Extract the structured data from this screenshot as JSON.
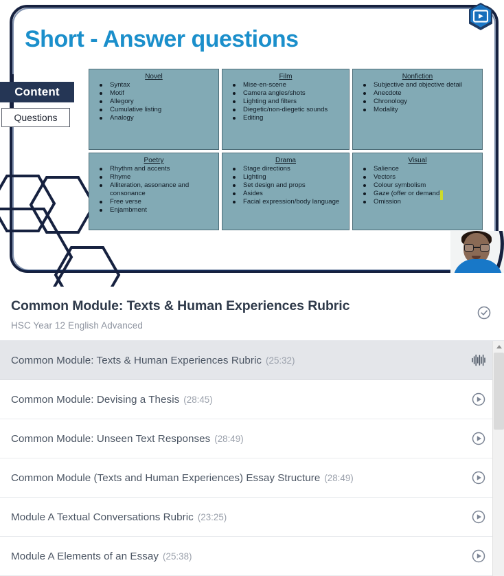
{
  "slide": {
    "title": "Short - Answer questions",
    "tabs": [
      {
        "label": "Content",
        "active": true
      },
      {
        "label": "Questions",
        "active": false
      }
    ],
    "logo_icon": "hex-play-logo-icon",
    "cursor_annotation_color": "#cddb2a",
    "box_fill": "#82aab5",
    "title_color": "#1b8fcb",
    "frame_color": "#16213f",
    "boxes": [
      {
        "heading": "Novel",
        "items": [
          "Syntax",
          "Motif",
          "Allegory",
          "Cumulative listing",
          "Analogy"
        ]
      },
      {
        "heading": "Film",
        "items": [
          "Mise-en-scene",
          "Camera angles/shots",
          "Lighting and filters",
          "Diegetic/non-diegetic sounds",
          "Editing"
        ]
      },
      {
        "heading": "Nonfiction",
        "items": [
          "Subjective and objective detail",
          "Anecdote",
          "Chronology",
          "Modality"
        ]
      },
      {
        "heading": "Poetry",
        "items": [
          "Rhythm and accents",
          "Rhyme",
          "Alliteration, assonance and consonance",
          "Free verse",
          "Enjambment"
        ]
      },
      {
        "heading": "Drama",
        "items": [
          "Stage directions",
          "Lighting",
          "Set design and props",
          "Asides",
          "Facial expression/body language"
        ]
      },
      {
        "heading": "Visual",
        "items": [
          "Salience",
          "Vectors",
          "Colour symbolism",
          "Gaze (offer or demand)",
          "Omission"
        ]
      }
    ]
  },
  "panel": {
    "title": "Common Module: Texts & Human Experiences Rubric",
    "subtitle": "HSC Year 12 English Advanced",
    "header_icon": "check-circle-icon",
    "tracks": [
      {
        "label": "Common Module: Texts & Human Experiences Rubric",
        "duration": "(25:32)",
        "active": true,
        "icon": "waveform-icon"
      },
      {
        "label": "Common Module: Devising a Thesis",
        "duration": "(28:45)",
        "active": false,
        "icon": "play-circle-icon"
      },
      {
        "label": "Common Module: Unseen Text Responses",
        "duration": "(28:49)",
        "active": false,
        "icon": "play-circle-icon"
      },
      {
        "label": "Common Module (Texts and Human Experiences) Essay Structure",
        "duration": "(28:49)",
        "active": false,
        "icon": "play-circle-icon"
      },
      {
        "label": "Module A Textual Conversations Rubric",
        "duration": "(23:25)",
        "active": false,
        "icon": "play-circle-icon"
      },
      {
        "label": "Module A Elements of an Essay",
        "duration": "(25:38)",
        "active": false,
        "icon": "play-circle-icon"
      }
    ]
  }
}
